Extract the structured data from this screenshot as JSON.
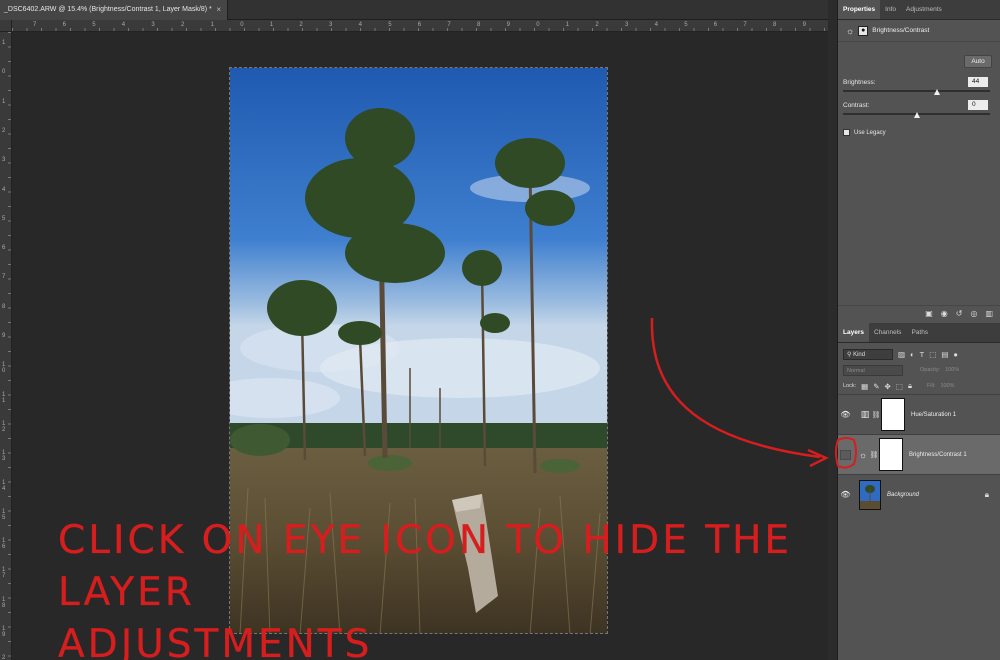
{
  "document": {
    "tab_title": "_DSC6402.ARW @ 15.4% (Brightness/Contrast 1, Layer Mask/8) *",
    "close_glyph": "×",
    "ruler_top_numbers": [
      "7",
      "6",
      "5",
      "4",
      "3",
      "2",
      "1",
      "0",
      "1",
      "2",
      "3",
      "4",
      "5",
      "6",
      "7",
      "8",
      "9",
      "0",
      "1",
      "2",
      "3",
      "4",
      "5",
      "6",
      "7",
      "8",
      "9"
    ],
    "ruler_left_numbers": [
      "1",
      "0",
      "1",
      "2",
      "3",
      "4",
      "5",
      "6",
      "7",
      "8",
      "9",
      "10",
      "11",
      "12",
      "13",
      "14",
      "15",
      "16",
      "17",
      "18",
      "19",
      "20"
    ]
  },
  "panel_tabs": [
    "Properties",
    "Info",
    "Adjustments"
  ],
  "properties": {
    "title": "Brightness/Contrast",
    "auto_label": "Auto",
    "brightness_label": "Brightness:",
    "brightness_value": "44",
    "contrast_label": "Contrast:",
    "contrast_value": "0",
    "legacy_label": "Use Legacy"
  },
  "layers_tabs": [
    "Layers",
    "Channels",
    "Paths"
  ],
  "layers_panel": {
    "kind_label": "Kind",
    "blend_mode": "Normal",
    "opacity_label": "Opacity:",
    "opacity_value": "100%",
    "lock_label": "Lock:",
    "fill_label": "Fill:",
    "fill_value": "100%"
  },
  "layers": [
    {
      "name": "Hue/Saturation 1",
      "visible": true,
      "type": "hue-saturation"
    },
    {
      "name": "Brightness/Contrast 1",
      "visible": false,
      "selected": true,
      "type": "brightness-contrast"
    },
    {
      "name": "Background",
      "visible": true,
      "locked": true,
      "type": "background"
    }
  ],
  "annotation": {
    "line1": "Click on eye icon to hide the layer",
    "line2": "adjustments",
    "color": "#d61e1e"
  },
  "colors": {
    "workspace": "#282828",
    "panel": "#535353",
    "selected_layer": "#6a6a6a",
    "sky": "#2f6bc0"
  }
}
